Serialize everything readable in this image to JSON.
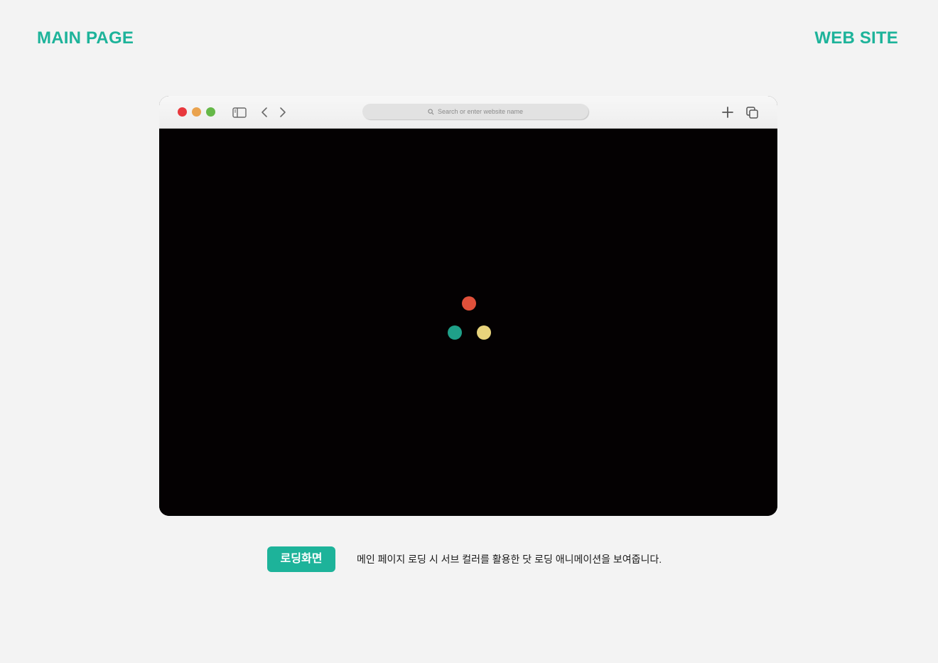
{
  "header": {
    "left_title": "MAIN PAGE",
    "right_title": "WEB SITE"
  },
  "browser": {
    "traffic_lights": [
      {
        "name": "close",
        "color": "#e8383d"
      },
      {
        "name": "minimize",
        "color": "#eaa34e"
      },
      {
        "name": "maximize",
        "color": "#65b848"
      }
    ],
    "toolbar_icons": {
      "sidebar": "sidebar-toggle-icon",
      "back": "chevron-left-icon",
      "forward": "chevron-right-icon",
      "new_tab": "plus-icon",
      "tabs": "tab-overview-icon",
      "search": "search-icon"
    },
    "address_bar": {
      "placeholder": "Search or enter website name"
    },
    "viewport_background": "#040102"
  },
  "loading_dots": [
    {
      "name": "red-dot",
      "color": "#e0503a"
    },
    {
      "name": "green-dot",
      "color": "#1fa089"
    },
    {
      "name": "yellow-dot",
      "color": "#e8d37c"
    }
  ],
  "caption": {
    "badge": "로딩화면",
    "description": "메인 페이지 로딩 시 서브 컬러를 활용한 닷 로딩 애니메이션을 보여줍니다."
  },
  "colors": {
    "accent": "#1db39a",
    "page_background": "#f3f3f3"
  }
}
